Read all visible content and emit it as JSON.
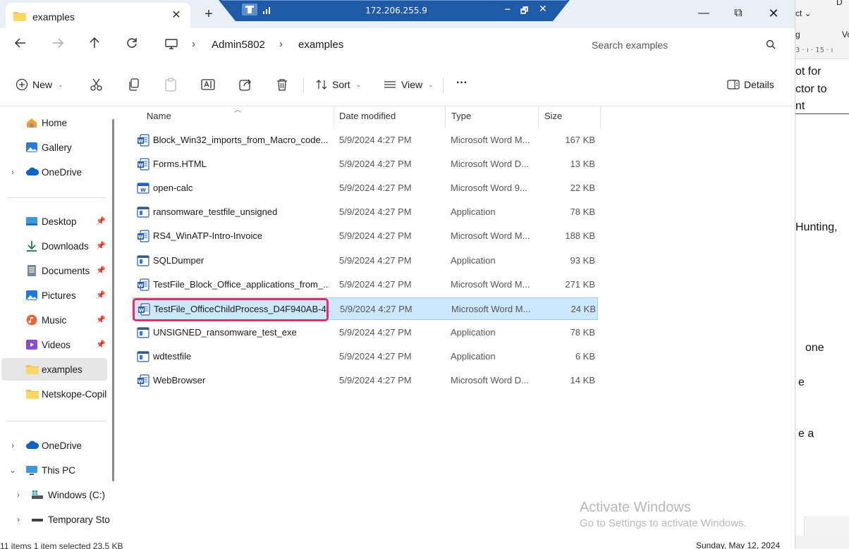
{
  "window": {
    "tab_title": "examples",
    "new_tab": "+",
    "close_tab": "✕",
    "minimize": "—",
    "maximize": "⧉",
    "close": "✕"
  },
  "remote_bar": {
    "ip": "172.206.255.9",
    "minimize": "–",
    "restore": "🗗",
    "close": "✕"
  },
  "address": {
    "crumbs": [
      "Admin5802",
      "examples"
    ],
    "separator": "›",
    "search_placeholder": "Search examples"
  },
  "commands": {
    "new": "New",
    "sort": "Sort",
    "view": "View",
    "more": "···",
    "details": "Details"
  },
  "sidebar": {
    "items": [
      {
        "label": "Home",
        "icon": "home-icon"
      },
      {
        "label": "Gallery",
        "icon": "gallery-icon"
      },
      {
        "label": "OneDrive",
        "icon": "cloud-icon",
        "expand": "›"
      },
      {
        "label": "Desktop",
        "icon": "desktop-icon",
        "pinned": true
      },
      {
        "label": "Downloads",
        "icon": "download-icon",
        "pinned": true
      },
      {
        "label": "Documents",
        "icon": "documents-icon",
        "pinned": true
      },
      {
        "label": "Pictures",
        "icon": "pictures-icon",
        "pinned": true
      },
      {
        "label": "Music",
        "icon": "music-icon",
        "pinned": true
      },
      {
        "label": "Videos",
        "icon": "videos-icon",
        "pinned": true
      },
      {
        "label": "examples",
        "icon": "folder-icon",
        "selected": true
      },
      {
        "label": "Netskope-Copil",
        "icon": "folder-icon"
      },
      {
        "label": "OneDrive",
        "icon": "cloud-icon",
        "expand": "›"
      },
      {
        "label": "This PC",
        "icon": "pc-icon",
        "expand": "⌄"
      },
      {
        "label": "Windows (C:)",
        "icon": "drive-icon",
        "expand": "›"
      },
      {
        "label": "Temporary Sto",
        "icon": "drive-icon",
        "expand": "›"
      }
    ]
  },
  "columns": {
    "name": "Name",
    "date": "Date modified",
    "type": "Type",
    "size": "Size"
  },
  "files": [
    {
      "name": "Block_Win32_imports_from_Macro_code...",
      "date": "5/9/2024 4:27 PM",
      "type": "Microsoft Word M...",
      "size": "167 KB",
      "icon": "word"
    },
    {
      "name": "Forms.HTML",
      "date": "5/9/2024 4:27 PM",
      "type": "Microsoft Word D...",
      "size": "13 KB",
      "icon": "word"
    },
    {
      "name": "open-calc",
      "date": "5/9/2024 4:27 PM",
      "type": "Microsoft Word 9...",
      "size": "22 KB",
      "icon": "word97"
    },
    {
      "name": "ransomware_testfile_unsigned",
      "date": "5/9/2024 4:27 PM",
      "type": "Application",
      "size": "78 KB",
      "icon": "app"
    },
    {
      "name": "RS4_WinATP-Intro-Invoice",
      "date": "5/9/2024 4:27 PM",
      "type": "Microsoft Word M...",
      "size": "188 KB",
      "icon": "word"
    },
    {
      "name": "SQLDumper",
      "date": "5/9/2024 4:27 PM",
      "type": "Application",
      "size": "93 KB",
      "icon": "app"
    },
    {
      "name": "TestFile_Block_Office_applications_from_...",
      "date": "5/9/2024 4:27 PM",
      "type": "Microsoft Word M...",
      "size": "271 KB",
      "icon": "word"
    },
    {
      "name": "TestFile_OfficeChildProcess_D4F940AB-4...",
      "date": "5/9/2024 4:27 PM",
      "type": "Microsoft Word M...",
      "size": "24 KB",
      "icon": "word",
      "selected": true
    },
    {
      "name": "UNSIGNED_ransomware_test_exe",
      "date": "5/9/2024 4:27 PM",
      "type": "Application",
      "size": "78 KB",
      "icon": "app"
    },
    {
      "name": "wdtestfile",
      "date": "5/9/2024 4:27 PM",
      "type": "Application",
      "size": "6 KB",
      "icon": "app"
    },
    {
      "name": "WebBrowser",
      "date": "5/9/2024 4:27 PM",
      "type": "Microsoft Word D...",
      "size": "14 KB",
      "icon": "word"
    }
  ],
  "watermark": {
    "title": "Activate Windows",
    "subtitle": "Go to Settings to activate Windows."
  },
  "status": {
    "text": "11 items    1 item selected  23.5 KB"
  },
  "background_word": {
    "ribbon_top": "D",
    "ribbon_item1": "ct ⌄",
    "ribbon_item2": "g",
    "ribbon_item3": "Vo",
    "ruler": "3 · ı · 15 · ı",
    "lines": [
      "ot for",
      "ctor to",
      "nt",
      "Hunting,",
      "one",
      "e",
      "e a"
    ],
    "date": "Sunday, May 12, 2024"
  },
  "colors": {
    "accent": "#0067c0",
    "selection_bg": "#cce8ff",
    "highlight_border": "#e0306a",
    "tabbar_bg": "#e9eef6",
    "remote_bar": "#1f5aa6"
  }
}
